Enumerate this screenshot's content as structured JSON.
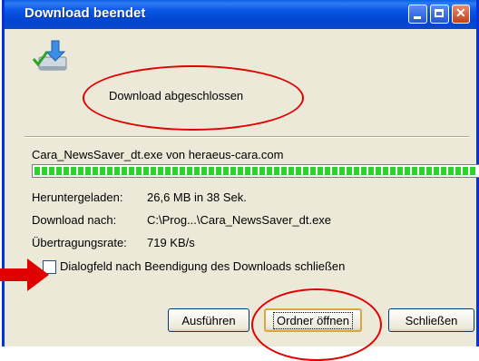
{
  "window": {
    "title": "Download beendet"
  },
  "status": {
    "text": "Download abgeschlossen"
  },
  "download": {
    "filename": "Cara_NewsSaver_dt.exe von heraeus-cara.com",
    "progress": 1.0,
    "details": [
      {
        "label": "Heruntergeladen:",
        "value": "26,6 MB in 38 Sek."
      },
      {
        "label": "Download nach:",
        "value": "C:\\Prog...\\Cara_NewsSaver_dt.exe"
      },
      {
        "label": "Übertragungsrate:",
        "value": "719 KB/s"
      }
    ]
  },
  "options": {
    "close_dialog_label": "Dialogfeld nach Beendigung des Downloads schließen",
    "close_dialog_checked": false
  },
  "buttons": {
    "run": "Ausführen",
    "open_folder": "Ordner öffnen",
    "close": "Schließen"
  },
  "colors": {
    "titlebar": "#0245d1",
    "progress": "#2bd32b",
    "annotation": "#e00000"
  }
}
